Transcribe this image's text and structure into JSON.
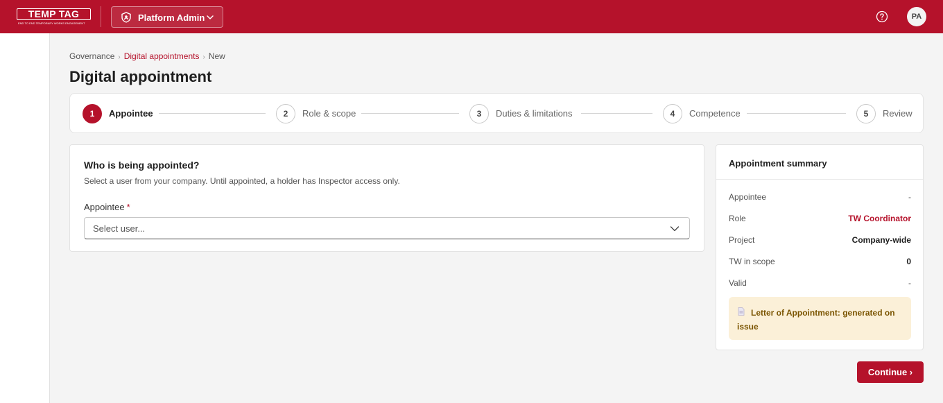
{
  "topbar": {
    "logo_text": "TEMP TAG",
    "logo_tagline": "END TO END TEMPORARY WORKS ENGAGEMENT",
    "platform_label": "Platform Admin",
    "help_icon": "question-circle-icon",
    "avatar_initials": "PA"
  },
  "breadcrumb": {
    "items": [
      "Governance",
      "Digital appointments",
      "New"
    ],
    "separator": "›"
  },
  "page": {
    "title": "Digital appointment"
  },
  "stepper": {
    "steps": [
      {
        "number": "1",
        "label": "Appointee",
        "active": true
      },
      {
        "number": "2",
        "label": "Role & scope",
        "active": false
      },
      {
        "number": "3",
        "label": "Duties & limitations",
        "active": false
      },
      {
        "number": "4",
        "label": "Competence",
        "active": false
      },
      {
        "number": "5",
        "label": "Review",
        "active": false
      }
    ]
  },
  "form": {
    "heading": "Who is being appointed?",
    "subtext": "Select a user from your company. Until appointed, a holder has Inspector access only.",
    "appointee_label": "Appointee",
    "required_marker": "*",
    "select_placeholder": "Select user..."
  },
  "summary": {
    "title": "Appointment summary",
    "rows": [
      {
        "key": "Appointee",
        "value": "-"
      },
      {
        "key": "Role",
        "value": "TW Coordinator"
      },
      {
        "key": "Project",
        "value": "Company-wide"
      },
      {
        "key": "TW in scope",
        "value": "0"
      },
      {
        "key": "Valid",
        "value": "-"
      }
    ],
    "letter_note": "Letter of Appointment: generated on issue"
  },
  "actions": {
    "continue_label": "Continue ›"
  },
  "colors": {
    "brand": "#b5122b",
    "note_bg": "#fbf0d8",
    "note_text": "#7a5400"
  }
}
